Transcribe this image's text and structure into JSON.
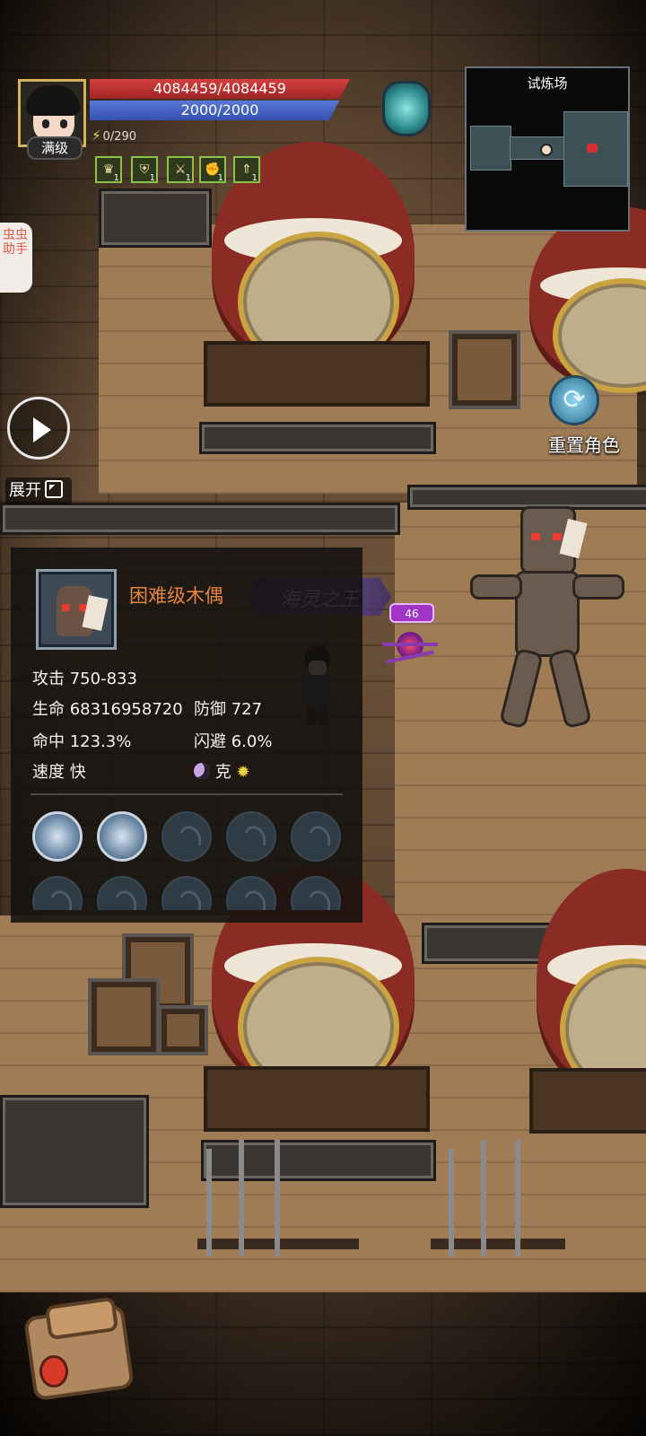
{
  "hud": {
    "hp_text": "4084459/4084459",
    "hp_fraction": 1.0,
    "mp_text": "2000/2000",
    "mp_fraction": 1.0,
    "energy_text": "0/290",
    "level_badge": "满级",
    "buffs": [
      {
        "icon": "warrior-buff-icon",
        "count": "1"
      },
      {
        "icon": "shield-buff-icon",
        "count": "1"
      },
      {
        "icon": "crossed-swords-buff-icon",
        "count": "1"
      },
      {
        "icon": "muscle-buff-icon",
        "count": "1"
      },
      {
        "icon": "rank-up-buff-icon",
        "count": "1"
      }
    ]
  },
  "minimap": {
    "title": "试炼场"
  },
  "side_tab": {
    "label": "虫虫助手"
  },
  "controls": {
    "expand_label": "展开",
    "reset_label": "重置角色"
  },
  "enemy": {
    "name": "困难级木偶",
    "attack": "攻击 750-833",
    "hp": "生命 68316958720",
    "defense": "防御 727",
    "accuracy": "命中 123.3%",
    "evasion": "闪避 6.0%",
    "speed": "速度 快",
    "counter_label": "克",
    "active_skills": [
      "flower-skill-icon",
      "mace-skill-icon"
    ],
    "empty_skill_slots": 8
  },
  "map": {
    "monster_level_tag": "46",
    "emblem_text": "海灵之王"
  },
  "colors": {
    "hp": "#c83030",
    "mp": "#4060c8",
    "enemy_name": "#e6843e",
    "buff_border": "#8bc34a"
  }
}
